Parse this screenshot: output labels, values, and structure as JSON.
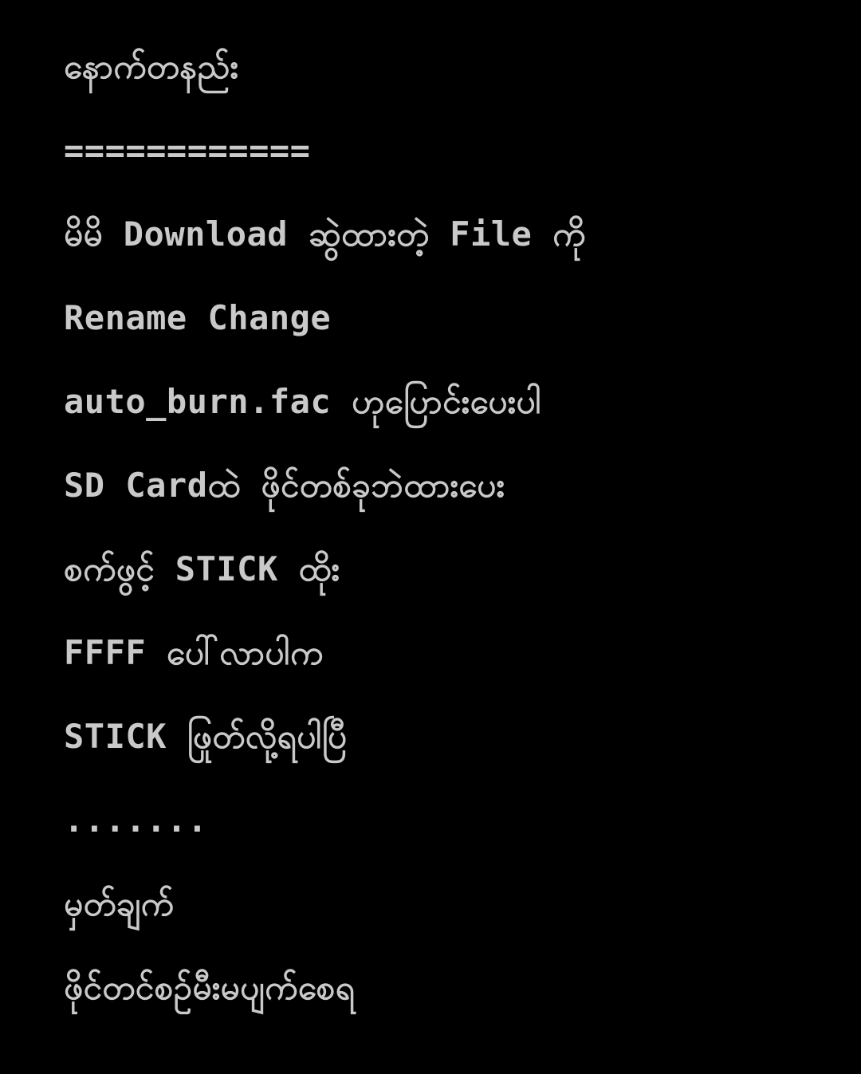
{
  "colors": {
    "background": "#000000",
    "text": "#c9c9c9"
  },
  "lines": [
    "နောက်တနည်း",
    "============",
    "မိမိ Download ဆွဲထားတဲ့ File ကို",
    "Rename Change",
    "auto_burn.fac ဟုပြောင်းပေးပါ",
    "SD Cardထဲ ဖိုင်တစ်ခုဘဲထားပေး",
    "စက်ဖွင့် STICK ထိုး",
    "FFFF ပေါ်လာပါက",
    "STICK ဖြုတ်လို့ရပါပြီ",
    ".......",
    "မှတ်ချက်",
    "ဖိုင်တင်စဉ်မီးမပျက်စေရ"
  ]
}
